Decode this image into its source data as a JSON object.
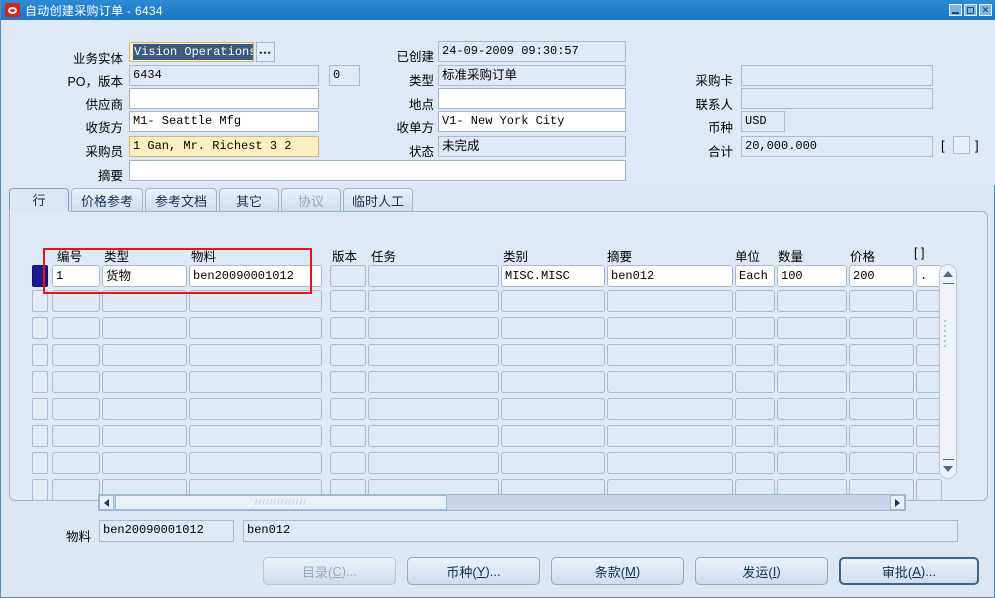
{
  "window": {
    "title": "自动创建采购订单 - 6434",
    "icon": "oracle-logo-icon",
    "minimize": "minimize-button",
    "maximize": "maximize-button",
    "close": "✕"
  },
  "header": {
    "left_fields": [
      {
        "label": "业务实体",
        "value": "Vision Operations",
        "state": "selected",
        "has_lov": true
      },
      {
        "label": "PO，版本",
        "value": "6434",
        "state": "readonly",
        "revision": "0"
      },
      {
        "label": "供应商",
        "value": "",
        "state": "editable"
      },
      {
        "label": "收货方",
        "value": "M1- Seattle Mfg",
        "state": "editable"
      },
      {
        "label": "采购员",
        "value": "1 Gan, Mr. Richest 3 2",
        "state": "highlight"
      },
      {
        "label": "摘要",
        "value": "",
        "state": "editable"
      }
    ],
    "mid_fields": [
      {
        "label": "已创建",
        "value": "24-09-2009 09:30:57",
        "state": "readonly"
      },
      {
        "label": "类型",
        "value": "标准采购订单",
        "state": "readonly"
      },
      {
        "label": "地点",
        "value": "",
        "state": "editable"
      },
      {
        "label": "收单方",
        "value": "V1- New York City",
        "state": "editable"
      },
      {
        "label": "状态",
        "value": "未完成",
        "state": "readonly"
      }
    ],
    "right_fields": [
      {
        "label": "采购卡",
        "value": "",
        "state": "readonly"
      },
      {
        "label": "联系人",
        "value": "",
        "state": "readonly"
      },
      {
        "label": "币种",
        "value": "USD",
        "state": "readonly"
      },
      {
        "label": "合计",
        "value": "20,000.000",
        "state": "readonly"
      }
    ],
    "bracket_open": "[",
    "bracket_close": "]"
  },
  "tabs": [
    {
      "label": "行",
      "active": true,
      "disabled": false
    },
    {
      "label": "价格参考",
      "active": false,
      "disabled": false
    },
    {
      "label": "参考文档",
      "active": false,
      "disabled": false
    },
    {
      "label": "其它",
      "active": false,
      "disabled": false
    },
    {
      "label": "协议",
      "active": false,
      "disabled": true
    },
    {
      "label": "临时人工",
      "active": false,
      "disabled": false
    }
  ],
  "grid": {
    "columns": [
      "编号",
      "类型",
      "物料",
      "版本",
      "任务",
      "类别",
      "摘要",
      "单位",
      "数量",
      "价格",
      "[   ]"
    ],
    "rows": [
      {
        "selected": true,
        "cells": [
          "1",
          "货物",
          "ben20090001012",
          "",
          "",
          "MISC.MISC",
          "ben012",
          "Each",
          "100",
          "200",
          "."
        ]
      },
      {
        "selected": false,
        "cells": [
          "",
          "",
          "",
          "",
          "",
          "",
          "",
          "",
          "",
          "",
          ""
        ]
      },
      {
        "selected": false,
        "cells": [
          "",
          "",
          "",
          "",
          "",
          "",
          "",
          "",
          "",
          "",
          ""
        ]
      },
      {
        "selected": false,
        "cells": [
          "",
          "",
          "",
          "",
          "",
          "",
          "",
          "",
          "",
          "",
          ""
        ]
      },
      {
        "selected": false,
        "cells": [
          "",
          "",
          "",
          "",
          "",
          "",
          "",
          "",
          "",
          "",
          ""
        ]
      },
      {
        "selected": false,
        "cells": [
          "",
          "",
          "",
          "",
          "",
          "",
          "",
          "",
          "",
          "",
          ""
        ]
      },
      {
        "selected": false,
        "cells": [
          "",
          "",
          "",
          "",
          "",
          "",
          "",
          "",
          "",
          "",
          ""
        ]
      },
      {
        "selected": false,
        "cells": [
          "",
          "",
          "",
          "",
          "",
          "",
          "",
          "",
          "",
          "",
          ""
        ]
      },
      {
        "selected": false,
        "cells": [
          "",
          "",
          "",
          "",
          "",
          "",
          "",
          "",
          "",
          "",
          ""
        ]
      }
    ]
  },
  "footer": {
    "material_label": "物料",
    "material_code": "ben20090001012",
    "material_desc": "ben012"
  },
  "buttons": [
    {
      "text_before": "目录(",
      "mnemonic": "C",
      "text_after": ")...",
      "disabled": true,
      "default": false
    },
    {
      "text_before": "币种(",
      "mnemonic": "Y",
      "text_after": ")...",
      "disabled": false,
      "default": false
    },
    {
      "text_before": "条款(",
      "mnemonic": "M",
      "text_after": ")",
      "disabled": false,
      "default": false
    },
    {
      "text_before": "发运(",
      "mnemonic": "I",
      "text_after": ")",
      "disabled": false,
      "default": false
    },
    {
      "text_before": "审批(",
      "mnemonic": "A",
      "text_after": ")...",
      "disabled": false,
      "default": true
    }
  ],
  "colors": {
    "titlebar": "#2180cc",
    "form_bg": "#dfe8f5",
    "field_border": "#9fb6d0",
    "highlight_field": "#fdf0c0",
    "selection": "#3c5a80",
    "red_box": "#e81313",
    "row_selector_active": "#1b1b8f"
  }
}
